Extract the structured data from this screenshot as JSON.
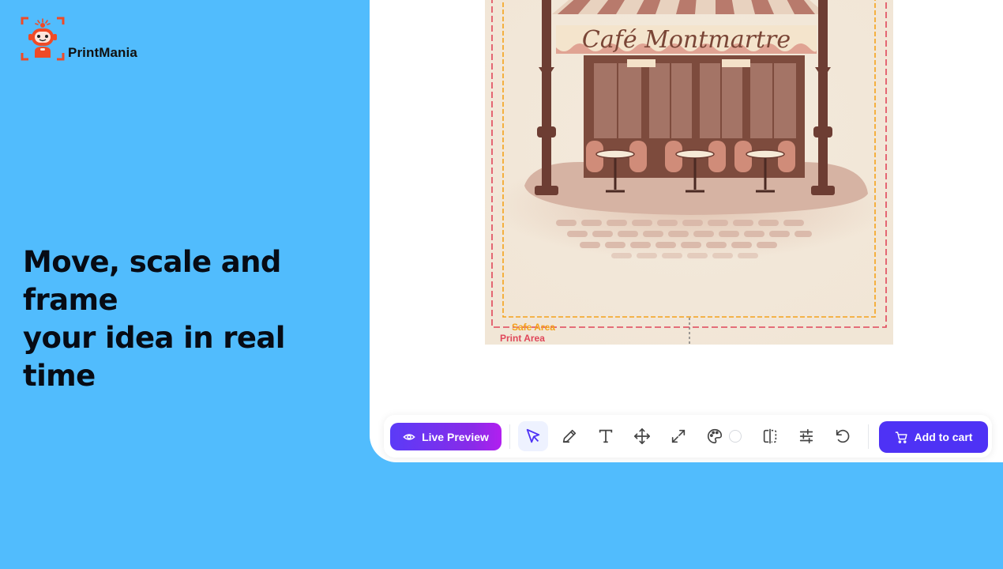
{
  "brand": {
    "name": "PrintMania",
    "accent": "#ef4a26"
  },
  "hero": {
    "line1": "Move, scale and frame",
    "line2": "your idea in real time"
  },
  "canvas": {
    "artwork_text": "Café Montmartre",
    "safe_area_label": "Safe Area",
    "print_area_label": "Print Area",
    "safe_area_color": "#f5a21b",
    "print_area_color": "#e0475a"
  },
  "toolbar": {
    "live_preview_label": "Live Preview",
    "add_to_cart_label": "Add to cart",
    "tools": [
      "select-icon",
      "pen-icon",
      "text-icon",
      "move-icon",
      "scale-icon",
      "palette-icon",
      "mirror-icon",
      "adjust-icon",
      "undo-icon"
    ],
    "active_tool": "select-icon"
  },
  "colors": {
    "background": "#51bcfd",
    "primary": "#4e32f5",
    "panel": "#ffffff"
  }
}
